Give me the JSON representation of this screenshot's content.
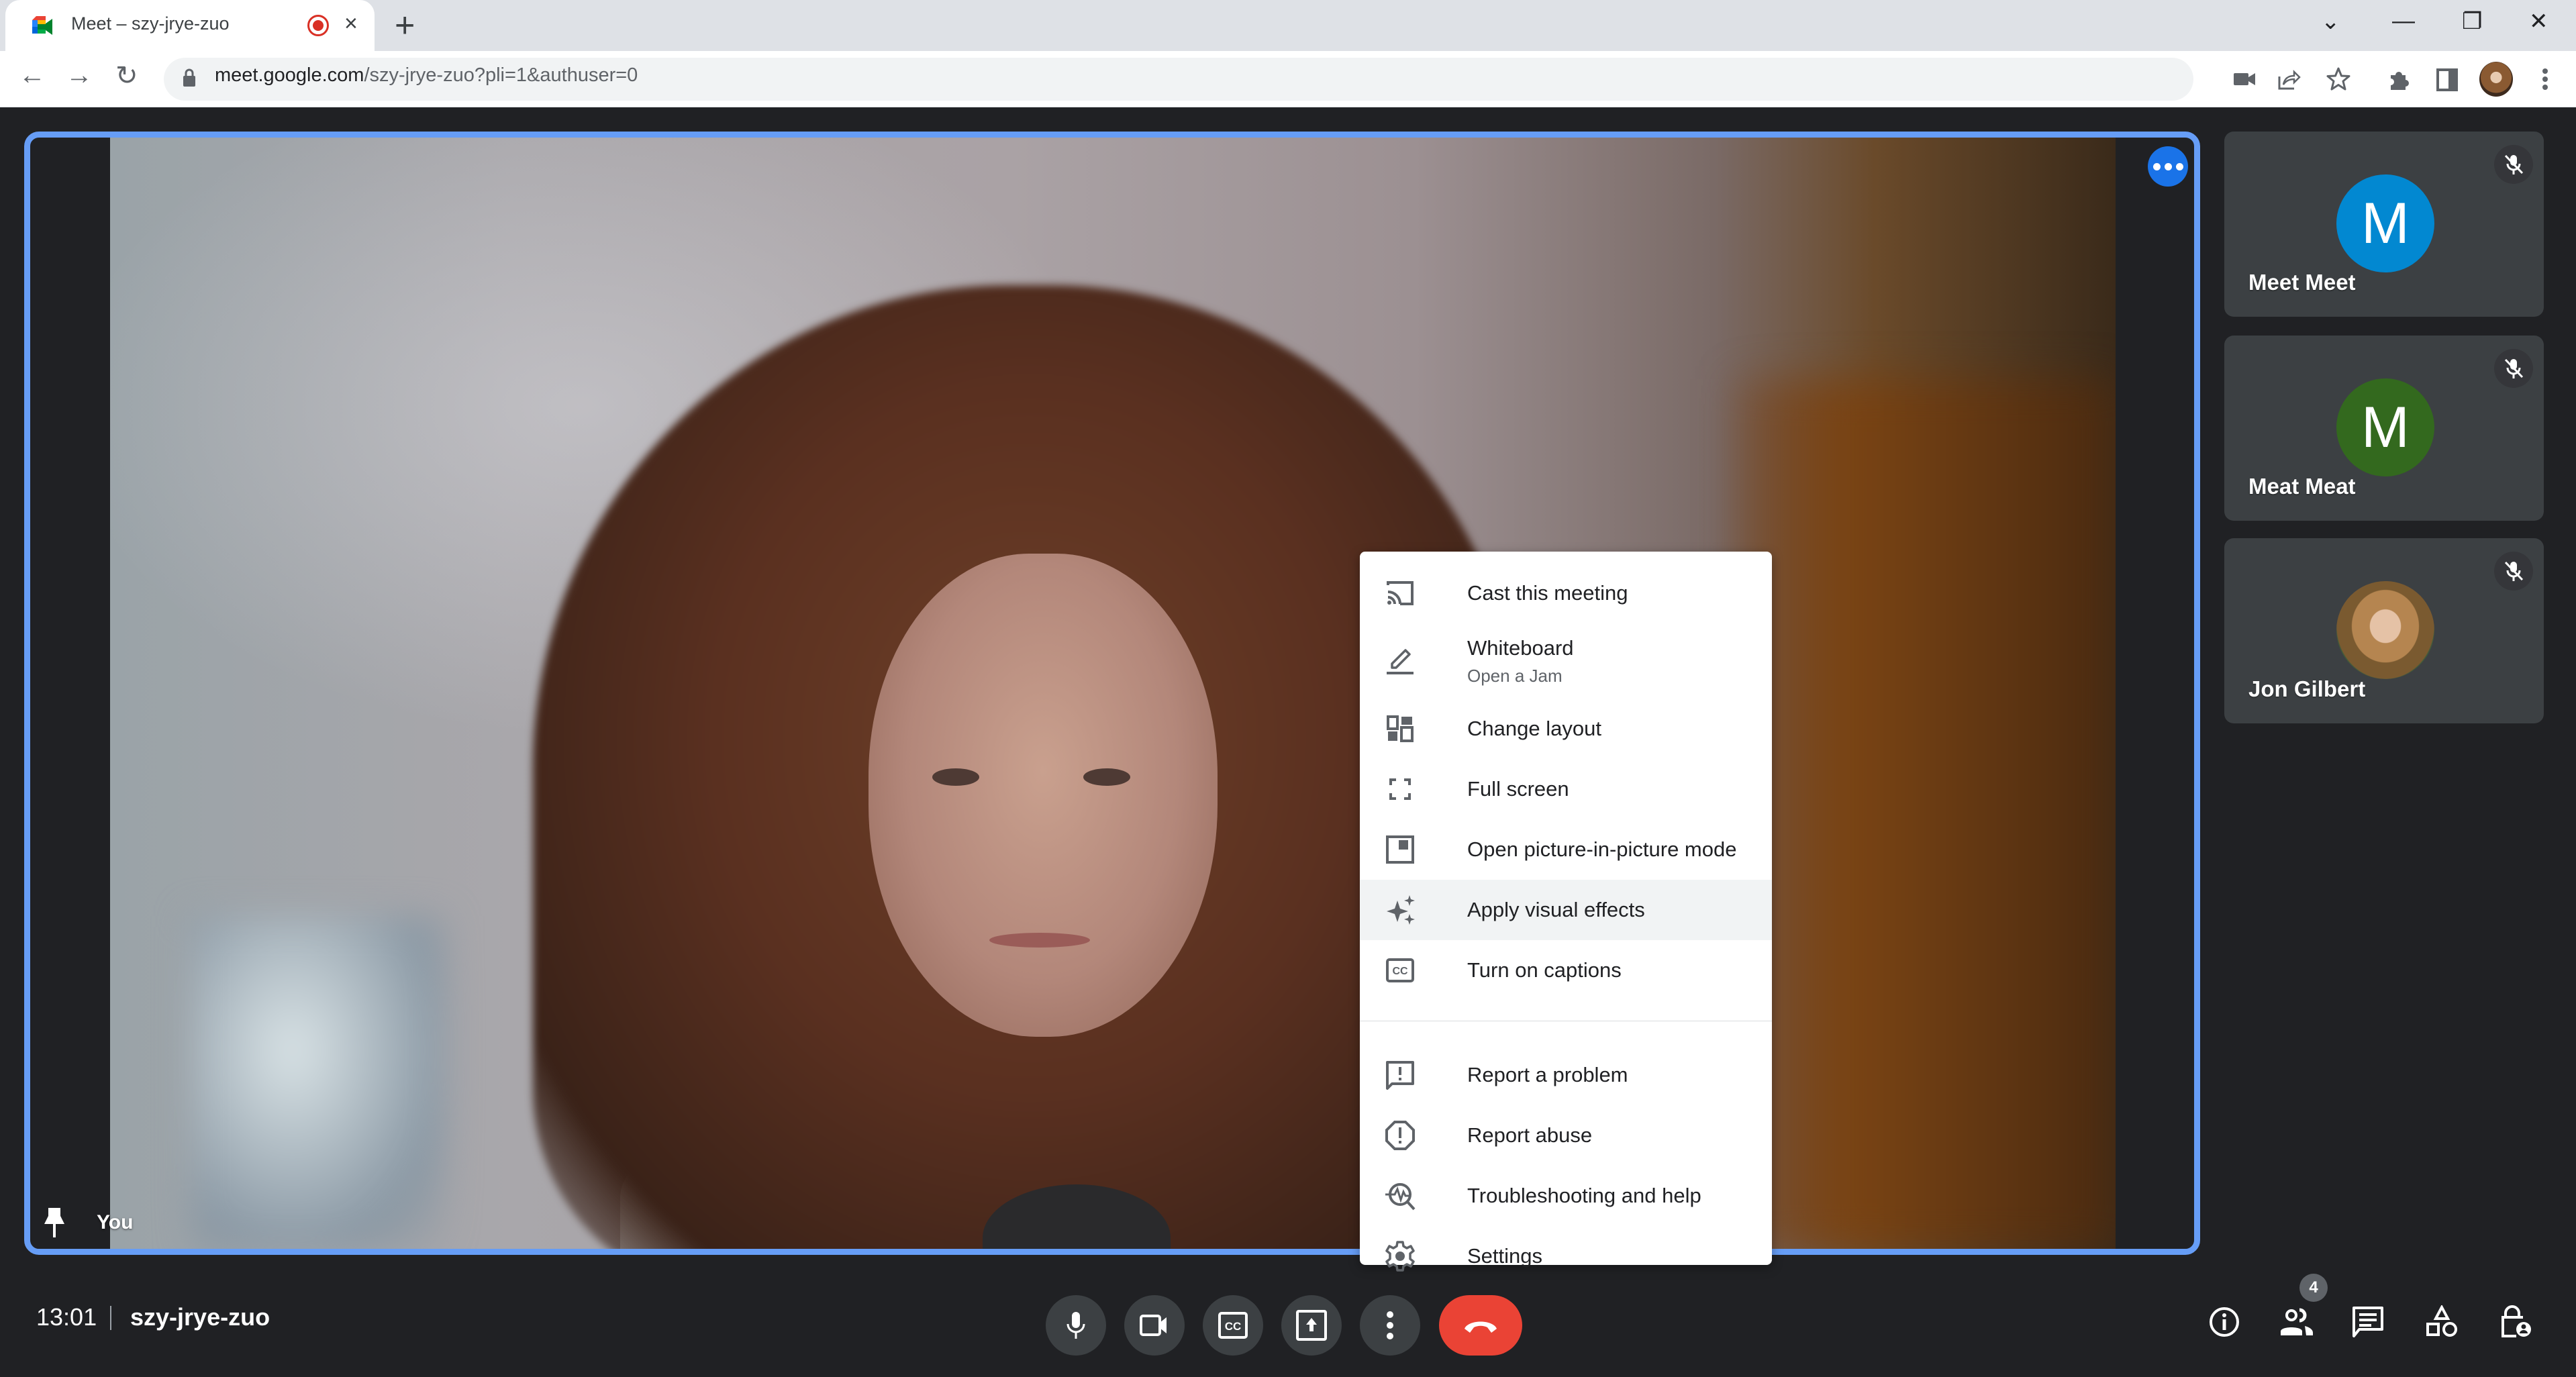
{
  "browser": {
    "tab_title": "Meet – szy-jrye-zuo",
    "tab_recording_indicator": "recording-icon",
    "tab_close": "×",
    "new_tab": "+",
    "window_controls": {
      "tab_search": "⌄",
      "minimize": "—",
      "restore": "❐",
      "close": "✕"
    },
    "nav": {
      "back": "←",
      "forward": "→",
      "reload": "↻"
    },
    "url_host": "meet.google.com",
    "url_path": "/szy-jrye-zuo?pli=1&authuser=0",
    "omnibox_icons": [
      "camera-icon",
      "share-icon",
      "star-icon"
    ],
    "toolbar_icons": [
      "extensions-icon",
      "side-panel-icon",
      "profile-avatar",
      "kebab-menu-icon"
    ]
  },
  "meeting": {
    "self_label": "You",
    "time": "13:01",
    "code": "szy-jrye-zuo",
    "participant_count": "4",
    "accent_color": "#669df6",
    "leave_color": "#ea4335"
  },
  "participants": [
    {
      "name": "Meet Meet",
      "initial": "M",
      "avatar_color": "#0288d1",
      "muted": true
    },
    {
      "name": "Meat Meat",
      "initial": "M",
      "avatar_color": "#33691e",
      "muted": true
    },
    {
      "name": "Jon Gilbert",
      "initial": "",
      "avatar_color": "",
      "muted": true,
      "photo": true
    }
  ],
  "menu": {
    "items": [
      {
        "label": "Cast this meeting",
        "icon": "cast-icon"
      },
      {
        "label": "Whiteboard",
        "sub": "Open a Jam",
        "icon": "pencil-icon"
      },
      {
        "label": "Change layout",
        "icon": "layout-icon"
      },
      {
        "label": "Full screen",
        "icon": "fullscreen-icon"
      },
      {
        "label": "Open picture-in-picture mode",
        "icon": "pip-icon"
      },
      {
        "label": "Apply visual effects",
        "icon": "sparkle-icon",
        "highlighted": true
      },
      {
        "label": "Turn on captions",
        "icon": "captions-icon"
      },
      {
        "label": "Report a problem",
        "icon": "feedback-icon"
      },
      {
        "label": "Report abuse",
        "icon": "report-icon"
      },
      {
        "label": "Troubleshooting and help",
        "icon": "troubleshoot-icon"
      },
      {
        "label": "Settings",
        "icon": "gear-icon"
      }
    ]
  },
  "controls": {
    "center": [
      "microphone",
      "camera",
      "captions",
      "present",
      "more-options",
      "leave-call"
    ],
    "right": [
      "meeting-details",
      "people",
      "chat",
      "activities",
      "host-controls"
    ]
  }
}
